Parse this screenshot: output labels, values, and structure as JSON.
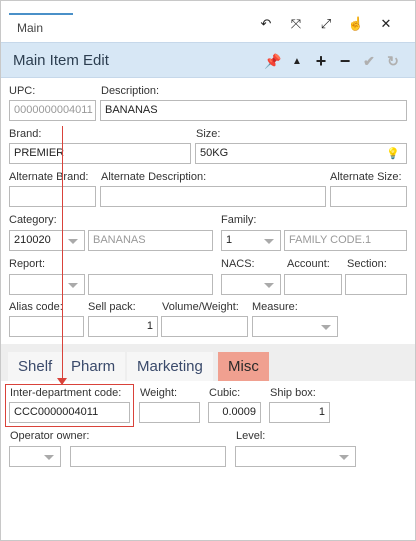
{
  "top_tab": {
    "label": "Main"
  },
  "top_icons": [
    "undo-icon",
    "collapse-icon",
    "expand-icon",
    "pointer-icon",
    "close-icon"
  ],
  "header": {
    "title": "Main Item Edit",
    "icons": [
      "pin-icon",
      "caret-up-icon",
      "plus-icon",
      "minus-icon",
      "check-icon",
      "reset-icon"
    ]
  },
  "form": {
    "upc": {
      "label": "UPC:",
      "value": "0000000004011"
    },
    "description": {
      "label": "Description:",
      "value": "BANANAS"
    },
    "brand": {
      "label": "Brand:",
      "value": "PREMIER"
    },
    "size": {
      "label": "Size:",
      "value": "50KG"
    },
    "alt_brand": {
      "label": "Alternate Brand:",
      "value": ""
    },
    "alt_description": {
      "label": "Alternate Description:",
      "value": ""
    },
    "alt_size": {
      "label": "Alternate Size:",
      "value": ""
    },
    "category": {
      "label": "Category:",
      "code": "210020",
      "name": "BANANAS"
    },
    "family": {
      "label": "Family:",
      "code": "1",
      "name": "FAMILY CODE.1"
    },
    "report": {
      "label": "Report:"
    },
    "nacs": {
      "label": "NACS:"
    },
    "account": {
      "label": "Account:"
    },
    "section": {
      "label": "Section:"
    },
    "alias_code": {
      "label": "Alias code:",
      "value": ""
    },
    "sell_pack": {
      "label": "Sell pack:",
      "value": "1"
    },
    "volume_weight": {
      "label": "Volume/Weight:",
      "value": ""
    },
    "measure": {
      "label": "Measure:"
    }
  },
  "tabs": [
    {
      "label": "Shelf",
      "active": false
    },
    {
      "label": "Pharm",
      "active": false
    },
    {
      "label": "Marketing",
      "active": false
    },
    {
      "label": "Misc",
      "active": true
    }
  ],
  "misc": {
    "inter_dept": {
      "label": "Inter-department code:",
      "value": "CCC0000004011"
    },
    "weight": {
      "label": "Weight:",
      "value": ""
    },
    "cubic": {
      "label": "Cubic:",
      "value": "0.0009"
    },
    "ship_box": {
      "label": "Ship box:",
      "value": "1"
    },
    "operator_owner": {
      "label": "Operator owner:"
    },
    "level": {
      "label": "Level:"
    }
  },
  "colors": {
    "header_bg": "#d7e7f5",
    "active_tab": "#f0a090",
    "annotation": "#d9423a",
    "accent": "#4a90c8"
  }
}
